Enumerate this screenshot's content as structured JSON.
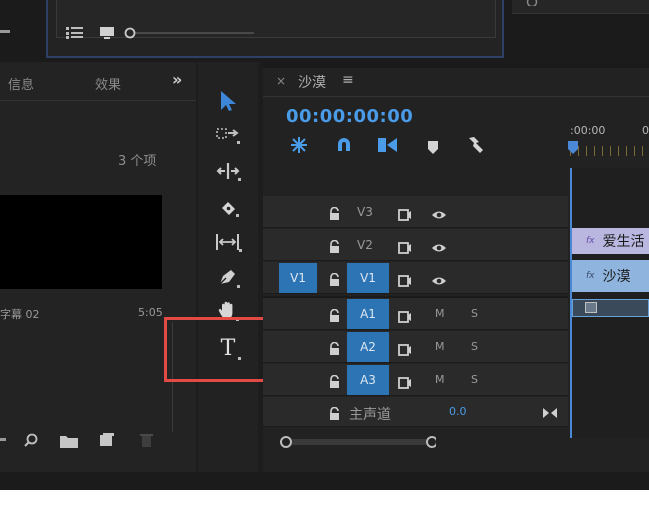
{
  "source_panel": {
    "list_icon": "list-view-icon",
    "monitor_icon": "monitor-icon"
  },
  "project_panel": {
    "tabs": [
      "信息",
      "效果"
    ],
    "overflow": "»",
    "item_count": "3 个项",
    "clip_name": "字幕 02",
    "clip_duration": "5:05",
    "bottom_icons": [
      "search-icon",
      "folder-icon",
      "new-item-icon",
      "trash-icon"
    ]
  },
  "tools": [
    {
      "name": "selection-tool-icon",
      "selected": true
    },
    {
      "name": "track-select-tool-icon"
    },
    {
      "name": "ripple-edit-tool-icon"
    },
    {
      "name": "razor-tool-icon"
    },
    {
      "name": "slip-tool-icon"
    },
    {
      "name": "pen-tool-icon"
    },
    {
      "name": "hand-tool-icon"
    },
    {
      "name": "type-tool-icon",
      "glyph": "T"
    }
  ],
  "timeline": {
    "close": "×",
    "sequence_name": "沙漠",
    "menu_glyph": "≡",
    "timecode": "00:00:00:00",
    "ruler_label": ":00:00",
    "ruler_label_2": "0",
    "tracks": [
      {
        "id": "V3",
        "lock": true,
        "target": false,
        "source": "",
        "type": "video"
      },
      {
        "id": "V2",
        "lock": true,
        "target": false,
        "source": "",
        "type": "video"
      },
      {
        "id": "V1",
        "lock": true,
        "target": true,
        "source": "V1",
        "type": "video"
      },
      {
        "id": "A1",
        "lock": true,
        "target": true,
        "source": "",
        "type": "audio",
        "m": "M",
        "s": "S"
      },
      {
        "id": "A2",
        "lock": true,
        "target": true,
        "source": "",
        "type": "audio",
        "m": "M",
        "s": "S"
      },
      {
        "id": "A3",
        "lock": true,
        "target": true,
        "source": "",
        "type": "audio",
        "m": "M",
        "s": "S"
      }
    ],
    "master_label": "主声道",
    "master_value": "0.0",
    "clips": [
      {
        "label": "爱生活",
        "fx": "fx"
      },
      {
        "label": "沙漠",
        "fx": "fx"
      }
    ]
  },
  "colors": {
    "accent_blue": "#2c74b4",
    "timecode_blue": "#4a9be8",
    "highlight_red": "#e24a45",
    "clip_purple": "#b9b7e0",
    "clip_blue": "#8fb5df"
  }
}
